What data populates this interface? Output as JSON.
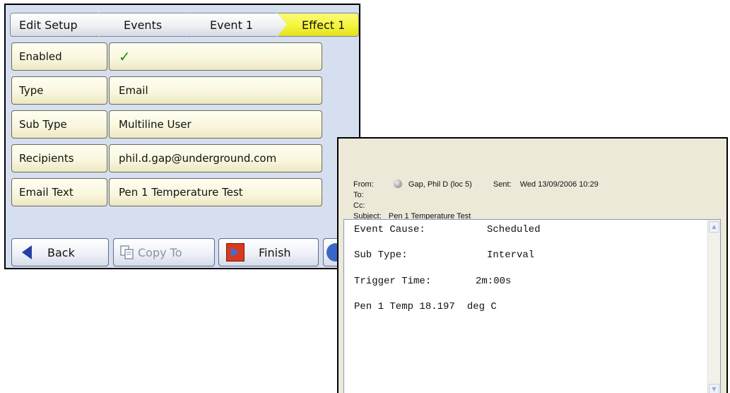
{
  "device": {
    "breadcrumb": [
      "Edit Setup",
      "Events",
      "Event 1",
      "Effect 1"
    ],
    "rows": [
      {
        "label": "Enabled",
        "value": "✓"
      },
      {
        "label": "Type",
        "value": "Email"
      },
      {
        "label": "Sub Type",
        "value": "Multiline User"
      },
      {
        "label": "Recipients",
        "value": "phil.d.gap@underground.com"
      },
      {
        "label": "Email Text",
        "value": "Pen 1 Temperature Test"
      }
    ],
    "buttons": {
      "back": "Back",
      "copy_to": "Copy To",
      "finish": "Finish"
    },
    "colors": {
      "active_crumb": "#f6f43a",
      "row_bg": "#f9f6dc",
      "panel_bg": "#d6dff0"
    }
  },
  "email": {
    "from_label": "From:",
    "from_value": "Gap, Phil D (loc 5)",
    "sent_label": "Sent:",
    "sent_value": "Wed 13/09/2006 10:29",
    "to_label": "To:",
    "cc_label": "Cc:",
    "subject_label": "Subject:",
    "subject_value": "Pen 1 Temperature Test",
    "body": [
      {
        "label": "Event Cause:",
        "value": "Scheduled"
      },
      {
        "label": "Sub Type:",
        "value": "Interval"
      },
      {
        "label": "Trigger Time:",
        "value": "2m:00s"
      },
      {
        "label": "Pen 1 Temp 18.197",
        "value": "deg C"
      }
    ]
  }
}
